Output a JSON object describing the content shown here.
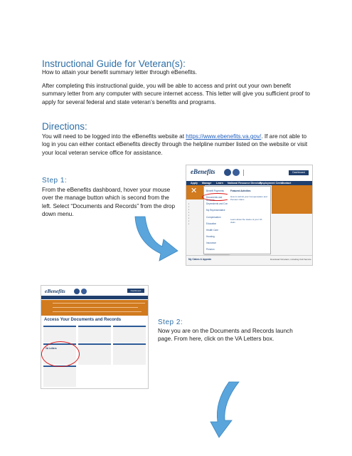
{
  "doc": {
    "title": "Instructional Guide for Veteran(s):",
    "subtitle": "How to attain your benefit summary letter through eBenefits.",
    "intro": "After completing this instructional guide, you will be able to access and print out your own benefit summary letter from any computer with secure internet access.  This letter will give you sufficient proof to apply for several federal and state veteran’s benefits and programs.",
    "directions_heading": "Directions:",
    "directions_before": "You will need to be logged into the eBenefits website at ",
    "directions_link": "https://www.ebenefits.va.gov/",
    "directions_after": ".  If are not able to log in you can either contact eBenefits directly through the helpline number listed on the website or visit your local veteran service office for assistance.",
    "step1_heading": "Step 1:",
    "step1_text": "From the eBenefits dashboard, hover your mouse over the manage button which is second from the left.  Select “Documents and Records” from the drop down menu.",
    "step2_heading": "Step 2:",
    "step2_text": "Now you are on the Documents and Records launch page.  From here, click on the VA Letters box."
  },
  "shot1": {
    "logo": "eBenefits",
    "dashboard_button": "Dashboard",
    "nav": [
      "Apply",
      "Manage",
      "Learn",
      "National Resource Directory",
      "Employment Center",
      "Contact"
    ],
    "menu_items": [
      "Benefit Payments",
      "Documents and Records",
      "Dependents and Contact Information",
      "My Representative",
      "Compensation",
      "Education",
      "Health Care",
      "Housing",
      "Insurance",
      "Pension"
    ],
    "featured_heading": "Featured Activities",
    "featured_text_1": "How to submit your Compensation and Pension Claim",
    "featured_text_2": "Learn about the status of your VA claim",
    "contact_left": "My Claims & Appeals",
    "footer_text": "Download VA letters, including Civil Service"
  },
  "shot2": {
    "logo": "eBenefits",
    "dashboard_button": "Dashboard",
    "page_title": "Access Your Documents and Records",
    "va_letters": "VA Letters"
  },
  "colors": {
    "heading": "#2e6fa7",
    "link": "#1f5fbf",
    "navy": "#1f3f6e",
    "orange": "#d17a1e",
    "arrow": "#5aa5dc",
    "circle": "#d7191c"
  }
}
